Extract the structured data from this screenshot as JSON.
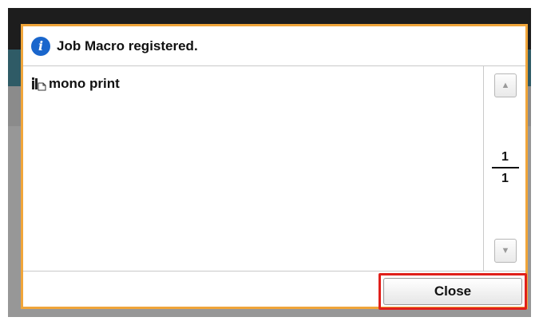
{
  "dialog": {
    "title": "Job Macro registered.",
    "icon": "info-icon",
    "accent_color": "#f0a53a"
  },
  "list": {
    "items": [
      {
        "label": "mono print",
        "icon": "macro-document-icon"
      }
    ]
  },
  "pagination": {
    "current": "1",
    "total": "1"
  },
  "footer": {
    "close_label": "Close",
    "highlight_color": "#e0201b"
  }
}
